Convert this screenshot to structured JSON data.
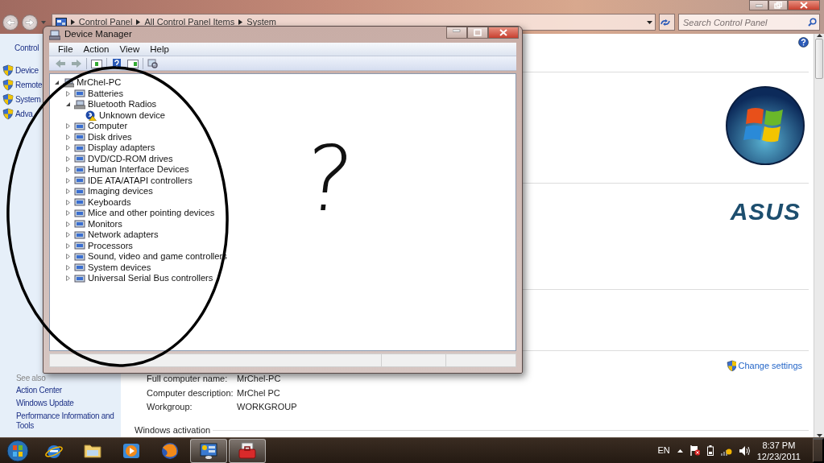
{
  "address_bar": {
    "breadcrumb": [
      "Control Panel",
      "All Control Panel Items",
      "System"
    ]
  },
  "search": {
    "placeholder": "Search Control Panel"
  },
  "sidebar": {
    "heading": "Control",
    "items": [
      "Device",
      "Remote",
      "System",
      "Adva"
    ],
    "see_also": "See also",
    "links": [
      "Action Center",
      "Windows Update",
      "Performance Information and Tools"
    ]
  },
  "content": {
    "brand": "ASUS",
    "change_settings": "Change settings",
    "computer_rows": [
      {
        "label": "Full computer name:",
        "value": "MrChel-PC"
      },
      {
        "label": "Computer description:",
        "value": "MrChel PC"
      },
      {
        "label": "Workgroup:",
        "value": "WORKGROUP"
      }
    ],
    "activation_heading": "Windows activation"
  },
  "device_manager": {
    "title": "Device Manager",
    "menu": [
      "File",
      "Action",
      "View",
      "Help"
    ],
    "tree": [
      {
        "label": "MrChel-PC",
        "expanded": true,
        "children": [
          {
            "label": "Batteries",
            "expanded": false
          },
          {
            "label": "Bluetooth Radios",
            "expanded": true,
            "children": [
              {
                "label": "Unknown device",
                "warning": true
              }
            ]
          },
          {
            "label": "Computer",
            "expanded": false
          },
          {
            "label": "Disk drives",
            "expanded": false
          },
          {
            "label": "Display adapters",
            "expanded": false
          },
          {
            "label": "DVD/CD-ROM drives",
            "expanded": false
          },
          {
            "label": "Human Interface Devices",
            "expanded": false
          },
          {
            "label": "IDE ATA/ATAPI controllers",
            "expanded": false
          },
          {
            "label": "Imaging devices",
            "expanded": false
          },
          {
            "label": "Keyboards",
            "expanded": false
          },
          {
            "label": "Mice and other pointing devices",
            "expanded": false
          },
          {
            "label": "Monitors",
            "expanded": false
          },
          {
            "label": "Network adapters",
            "expanded": false
          },
          {
            "label": "Processors",
            "expanded": false
          },
          {
            "label": "Sound, video and game controllers",
            "expanded": false
          },
          {
            "label": "System devices",
            "expanded": false
          },
          {
            "label": "Universal Serial Bus controllers",
            "expanded": false
          }
        ]
      }
    ]
  },
  "annotation": {
    "text": "?"
  },
  "taskbar": {
    "apps": [
      {
        "kind": "ie",
        "selected": false
      },
      {
        "kind": "folder",
        "selected": false
      },
      {
        "kind": "player",
        "selected": false
      },
      {
        "kind": "firefox",
        "selected": false
      },
      {
        "kind": "panel",
        "selected": true
      },
      {
        "kind": "toolbox",
        "selected": true
      }
    ]
  },
  "tray": {
    "language": "EN",
    "time": "8:37 PM",
    "date": "12/23/2011"
  }
}
